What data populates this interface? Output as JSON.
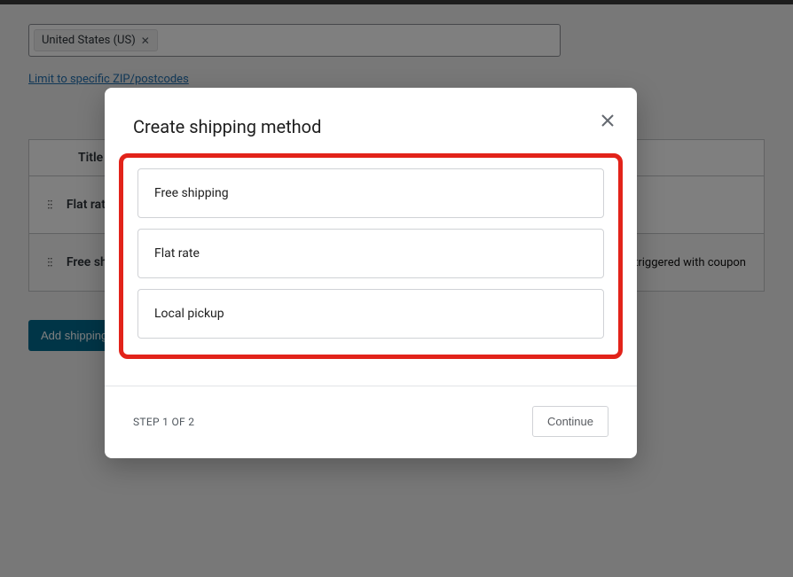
{
  "zone": {
    "region_chip": "United States (US)",
    "limit_link": "Limit to specific ZIP/postcodes"
  },
  "table": {
    "header_title": "Title",
    "rows": [
      {
        "title": "Flat rate",
        "desc": ""
      },
      {
        "title": "Free shipping",
        "desc": "an be triggered with coupon"
      }
    ]
  },
  "buttons": {
    "add_shipping": "Add shipping"
  },
  "modal": {
    "title": "Create shipping method",
    "options": [
      "Free shipping",
      "Flat rate",
      "Local pickup"
    ],
    "step": "STEP 1 OF 2",
    "continue": "Continue"
  }
}
